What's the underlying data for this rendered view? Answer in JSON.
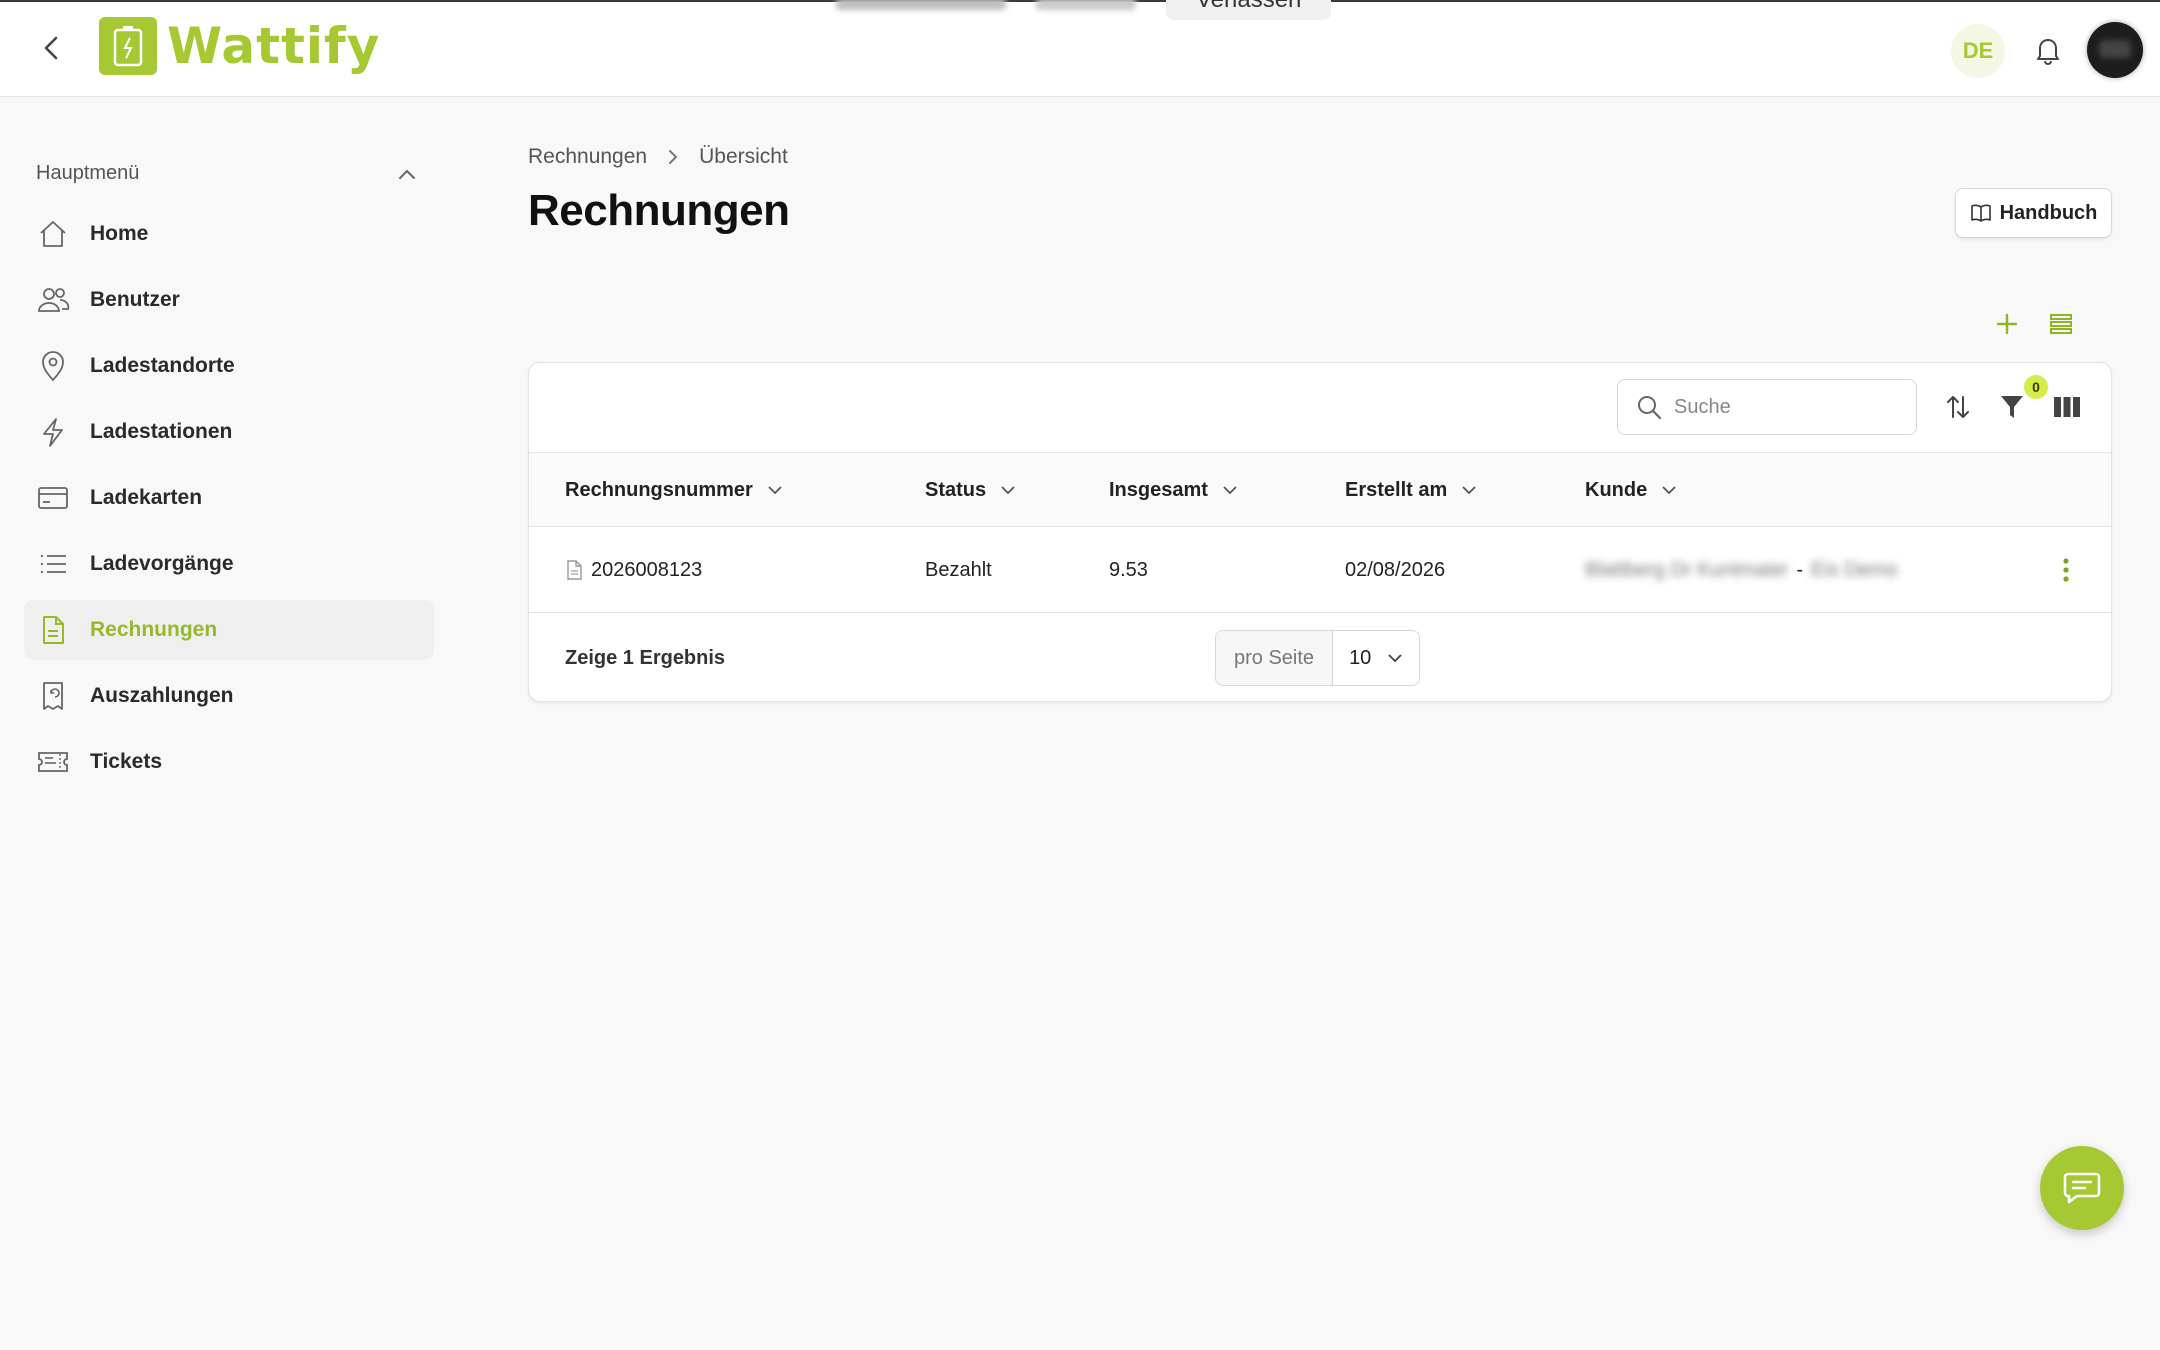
{
  "app": {
    "name": "Wattify",
    "brand_color": "#a6c832",
    "active_color": "#95b92b"
  },
  "topbar": {
    "leave_label": "Verlassen",
    "language": "DE",
    "icons": {
      "back": "chevron-left-icon",
      "bell": "bell-icon",
      "avatar": "avatar"
    }
  },
  "sidebar": {
    "header": "Hauptmenü",
    "items": [
      {
        "label": "Home",
        "icon": "home-icon",
        "active": false
      },
      {
        "label": "Benutzer",
        "icon": "users-icon",
        "active": false
      },
      {
        "label": "Ladestandorte",
        "icon": "location-pin-icon",
        "active": false
      },
      {
        "label": "Ladestationen",
        "icon": "lightning-icon",
        "active": false
      },
      {
        "label": "Ladekarten",
        "icon": "credit-card-icon",
        "active": false
      },
      {
        "label": "Ladevorgänge",
        "icon": "list-icon",
        "active": false
      },
      {
        "label": "Rechnungen",
        "icon": "document-icon",
        "active": true
      },
      {
        "label": "Auszahlungen",
        "icon": "receipt-refund-icon",
        "active": false
      },
      {
        "label": "Tickets",
        "icon": "ticket-icon",
        "active": false
      }
    ]
  },
  "main": {
    "breadcrumb": [
      "Rechnungen",
      "Übersicht"
    ],
    "title": "Rechnungen",
    "manual_label": "Handbuch",
    "search": {
      "placeholder": "Suche",
      "value": ""
    },
    "filter_count": "0",
    "table": {
      "columns": [
        "Rechnungsnummer",
        "Status",
        "Insgesamt",
        "Erstellt am",
        "Kunde"
      ],
      "rows": [
        {
          "invoice_number": "2026008123",
          "status": "Bezahlt",
          "total": "9.53",
          "created": "02/08/2026",
          "customer_a": "Blattberg Dr Kuntmaier",
          "customer_sep": "-",
          "customer_b": "Eis Demo"
        }
      ]
    },
    "result_text": "Zeige 1 Ergebnis",
    "per_page_label": "pro Seite",
    "per_page_value": "10"
  }
}
